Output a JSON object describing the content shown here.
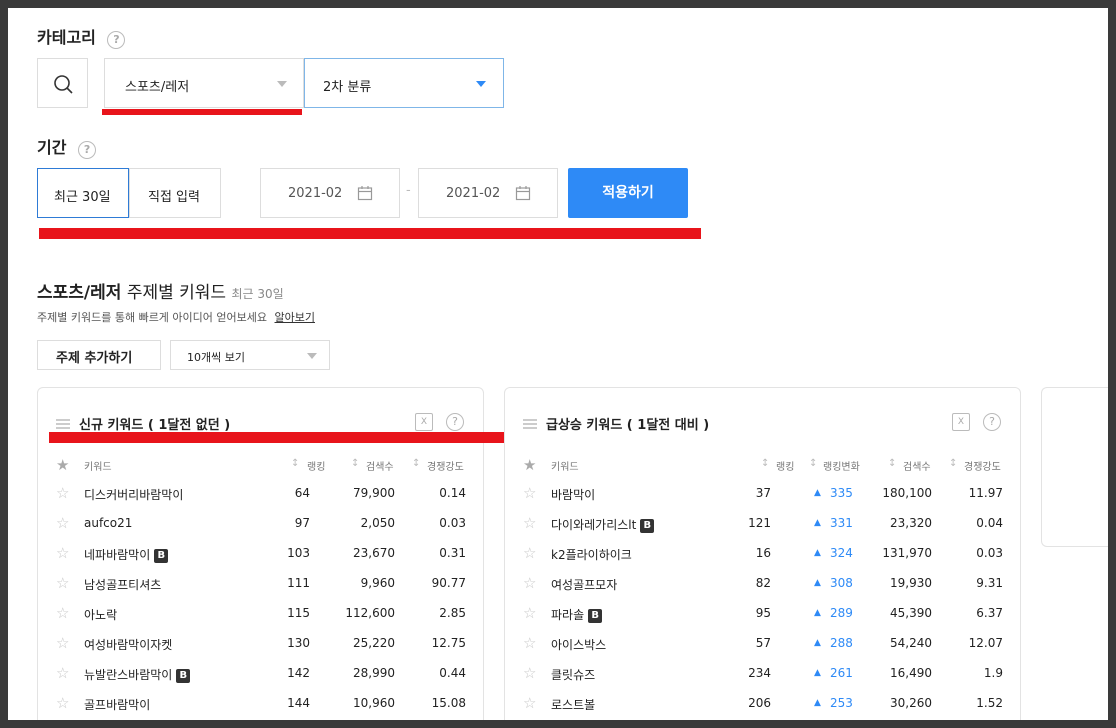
{
  "category": {
    "label": "카테고리",
    "help": "?",
    "primary_select": "스포츠/레저",
    "secondary_select": "2차 분류"
  },
  "period": {
    "label": "기간",
    "help": "?",
    "recent_button": "최근 30일",
    "custom_button": "직접 입력",
    "start_date": "2021-02",
    "end_date": "2021-02",
    "separator": "-",
    "apply_button": "적용하기"
  },
  "section": {
    "title_bold": "스포츠/레저",
    "title_rest": "주제별 키워드",
    "title_sub": "최근 30일",
    "description": "주제별 키워드를 통해 빠르게 아이디어 얻어보세요",
    "learn_more": "알아보기",
    "add_topic_button": "주제 추가하기",
    "view_select": "10개씩 보기"
  },
  "panel_new": {
    "title": "신규 키워드 ( 1달전 없던 )",
    "headers": {
      "keyword": "키워드",
      "rank": "랭킹",
      "search": "검색수",
      "competition": "경쟁강도"
    },
    "rows": [
      {
        "keyword": "디스커버리바람막이",
        "badge": "",
        "rank": "64",
        "search": "79,900",
        "competition": "0.14"
      },
      {
        "keyword": "aufco21",
        "badge": "",
        "rank": "97",
        "search": "2,050",
        "competition": "0.03"
      },
      {
        "keyword": "네파바람막이",
        "badge": "B",
        "rank": "103",
        "search": "23,670",
        "competition": "0.31"
      },
      {
        "keyword": "남성골프티셔츠",
        "badge": "",
        "rank": "111",
        "search": "9,960",
        "competition": "90.77"
      },
      {
        "keyword": "아노락",
        "badge": "",
        "rank": "115",
        "search": "112,600",
        "competition": "2.85"
      },
      {
        "keyword": "여성바람막이자켓",
        "badge": "",
        "rank": "130",
        "search": "25,220",
        "competition": "12.75"
      },
      {
        "keyword": "뉴발란스바람막이",
        "badge": "B",
        "rank": "142",
        "search": "28,990",
        "competition": "0.44"
      },
      {
        "keyword": "골프바람막이",
        "badge": "",
        "rank": "144",
        "search": "10,960",
        "competition": "15.08"
      }
    ]
  },
  "panel_rising": {
    "title": "급상승 키워드 ( 1달전 대비 )",
    "headers": {
      "keyword": "키워드",
      "rank": "랭킹",
      "rank_change": "랭킹변화",
      "search": "검색수",
      "competition": "경쟁강도"
    },
    "rows": [
      {
        "keyword": "바람막이",
        "badge": "",
        "rank": "37",
        "change": "335",
        "search": "180,100",
        "competition": "11.97"
      },
      {
        "keyword": "다이와레가리스lt",
        "badge": "B",
        "rank": "121",
        "change": "331",
        "search": "23,320",
        "competition": "0.04"
      },
      {
        "keyword": "k2플라이하이크",
        "badge": "",
        "rank": "16",
        "change": "324",
        "search": "131,970",
        "competition": "0.03"
      },
      {
        "keyword": "여성골프모자",
        "badge": "",
        "rank": "82",
        "change": "308",
        "search": "19,930",
        "competition": "9.31"
      },
      {
        "keyword": "파라솔",
        "badge": "B",
        "rank": "95",
        "change": "289",
        "search": "45,390",
        "competition": "6.37"
      },
      {
        "keyword": "아이스박스",
        "badge": "",
        "rank": "57",
        "change": "288",
        "search": "54,240",
        "competition": "12.07"
      },
      {
        "keyword": "클릿슈즈",
        "badge": "",
        "rank": "234",
        "change": "261",
        "search": "16,490",
        "competition": "1.9"
      },
      {
        "keyword": "로스트볼",
        "badge": "",
        "rank": "206",
        "change": "253",
        "search": "30,260",
        "competition": "1.52"
      }
    ]
  },
  "colors": {
    "accent": "#2e8af6",
    "highlight_underline": "#e8141b",
    "badge_bg": "#333333"
  }
}
